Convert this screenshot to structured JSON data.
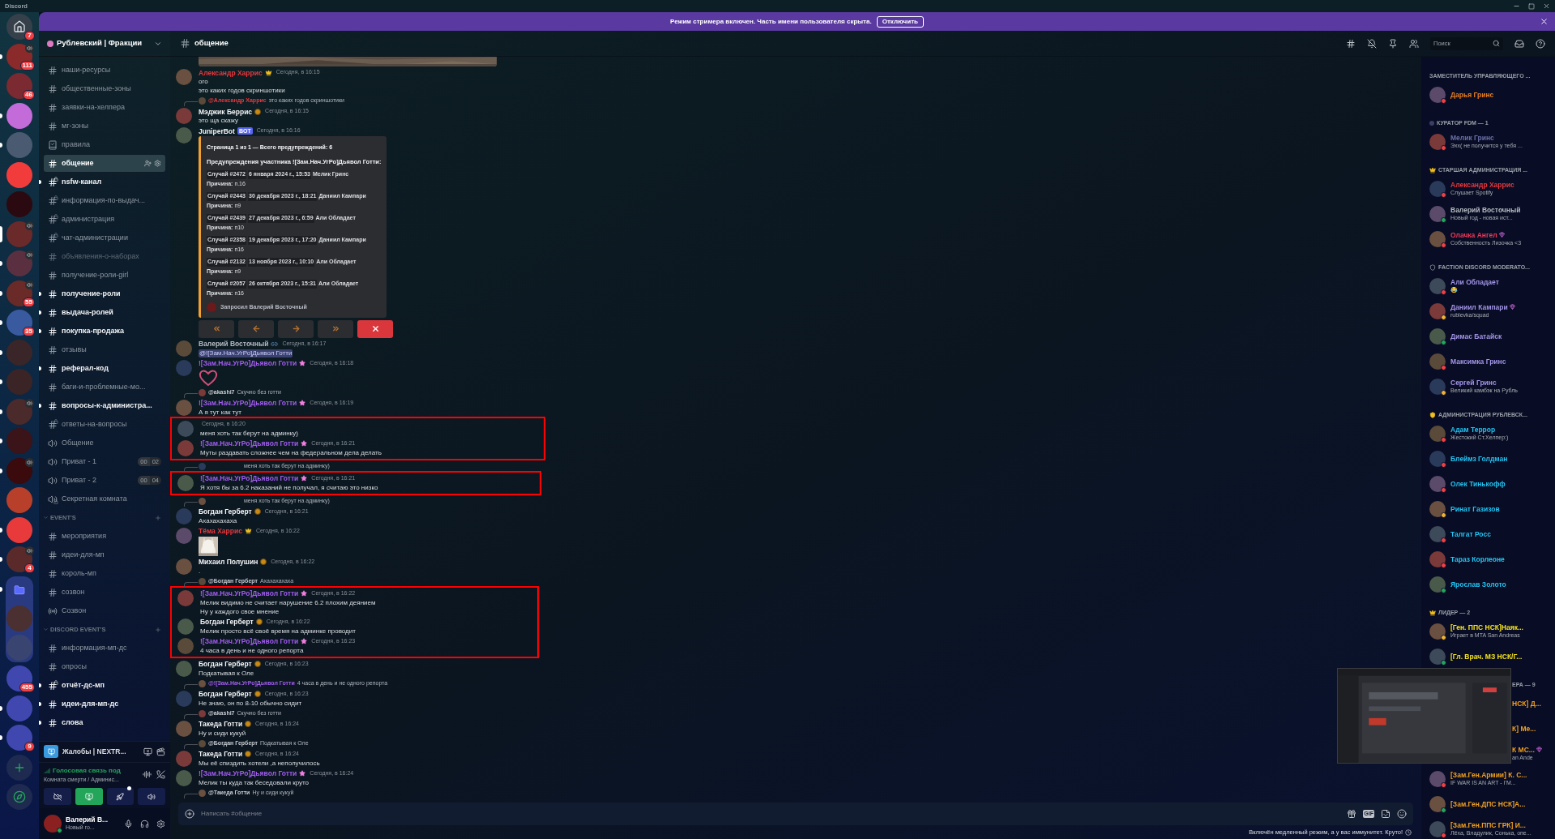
{
  "title_bar": {
    "app_name": "Discord"
  },
  "banner": {
    "text": "Режим стримера включен. Часть имени пользователя скрыта.",
    "button": "Отключить"
  },
  "servers": [
    {
      "kind": "home",
      "badge": "7",
      "unread": false,
      "selected": false,
      "speaker": false
    },
    {
      "kind": "server",
      "color": "#8a2a2a",
      "badge": "111",
      "unread": true,
      "selected": false,
      "speaker": true
    },
    {
      "kind": "server",
      "color": "#7a2a30",
      "badge": "46",
      "unread": false,
      "selected": false,
      "speaker": false
    },
    {
      "kind": "server",
      "color": "#c36bd9",
      "unread": true,
      "selected": false,
      "speaker": false
    },
    {
      "kind": "server",
      "color": "#4a5a70",
      "unread": true,
      "selected": false,
      "speaker": false
    },
    {
      "kind": "server",
      "color": "#f23c3c",
      "unread": false,
      "selected": false,
      "speaker": false
    },
    {
      "kind": "server",
      "color": "#2a0a10",
      "unread": false,
      "selected": false,
      "speaker": false
    },
    {
      "kind": "server",
      "color": "#6a2a2a",
      "unread": false,
      "selected": true,
      "speaker": true
    },
    {
      "kind": "server",
      "color": "#5a3040",
      "unread": true,
      "selected": false,
      "speaker": true
    },
    {
      "kind": "server",
      "color": "#6a2a28",
      "badge": "55",
      "unread": true,
      "selected": false,
      "speaker": true
    },
    {
      "kind": "server",
      "color": "#3a5aa0",
      "badge": "35",
      "unread": true,
      "selected": false,
      "speaker": false
    },
    {
      "kind": "server",
      "color": "#3a2628",
      "unread": true,
      "selected": false,
      "speaker": false
    },
    {
      "kind": "server",
      "color": "#3a2426",
      "unread": true,
      "selected": false,
      "speaker": false
    },
    {
      "kind": "server",
      "color": "#4a2a2a",
      "unread": true,
      "selected": false,
      "speaker": true
    },
    {
      "kind": "server",
      "color": "#3a1418",
      "unread": true,
      "selected": false,
      "speaker": false
    },
    {
      "kind": "server",
      "color": "#3a0a0c",
      "unread": true,
      "selected": false,
      "speaker": true
    },
    {
      "kind": "server",
      "color": "#b8402a",
      "unread": false,
      "selected": false,
      "speaker": false
    },
    {
      "kind": "server",
      "color": "#e83a3a",
      "unread": true,
      "selected": false,
      "speaker": false
    },
    {
      "kind": "server",
      "color": "#5a2a2a",
      "badge": "4",
      "unread": true,
      "selected": false,
      "speaker": true
    },
    {
      "kind": "folder",
      "children": [
        {
          "color": "#4a3030"
        },
        {
          "color": "#3a4470"
        }
      ],
      "unread": true,
      "selected": false,
      "speaker": false
    },
    {
      "kind": "server",
      "color": "#4048b0",
      "badge": "455",
      "unread": false,
      "selected": false,
      "speaker": false
    },
    {
      "kind": "server",
      "color": "#4048b0",
      "unread": true,
      "selected": false,
      "speaker": false
    },
    {
      "kind": "server",
      "color": "#4048b0",
      "badge": "9",
      "unread": true,
      "selected": false,
      "speaker": false
    },
    {
      "kind": "add",
      "unread": false,
      "selected": false,
      "speaker": false
    },
    {
      "kind": "discover",
      "unread": false,
      "selected": false,
      "speaker": false
    }
  ],
  "server": {
    "name": "Рублевский | Фракции"
  },
  "channels": [
    {
      "kind": "text",
      "name": "наши-ресурсы",
      "selected": false,
      "unread": false,
      "muted": false
    },
    {
      "kind": "text",
      "name": "общественные-зоны",
      "selected": false,
      "unread": false,
      "muted": false
    },
    {
      "kind": "text",
      "name": "заявки-на-хелпера",
      "selected": false,
      "unread": false,
      "muted": false
    },
    {
      "kind": "text",
      "name": "мг-зоны",
      "selected": false,
      "unread": false,
      "muted": false
    },
    {
      "kind": "rules",
      "name": "правила",
      "selected": false,
      "unread": false,
      "muted": false
    },
    {
      "kind": "text",
      "name": "общение",
      "selected": true,
      "unread": false,
      "muted": false
    },
    {
      "kind": "limited",
      "name": "nsfw-канал",
      "selected": false,
      "unread": true,
      "muted": false
    },
    {
      "kind": "limited",
      "name": "информация-по-выдач...",
      "selected": false,
      "unread": false,
      "muted": false
    },
    {
      "kind": "limited",
      "name": "администрация",
      "selected": false,
      "unread": false,
      "muted": false
    },
    {
      "kind": "limited",
      "name": "чат-администрации",
      "selected": false,
      "unread": false,
      "muted": false
    },
    {
      "kind": "text",
      "name": "объявления-о-наборах",
      "selected": false,
      "unread": false,
      "muted": true
    },
    {
      "kind": "text",
      "name": "получение-роли-girl",
      "selected": false,
      "unread": false,
      "muted": false
    },
    {
      "kind": "text",
      "name": "получение-роли",
      "selected": false,
      "unread": true,
      "muted": false
    },
    {
      "kind": "text",
      "name": "выдача-ролей",
      "selected": false,
      "unread": true,
      "muted": false
    },
    {
      "kind": "text",
      "name": "покупка-продажа",
      "selected": false,
      "unread": true,
      "muted": false
    },
    {
      "kind": "text",
      "name": "отзывы",
      "selected": false,
      "unread": false,
      "muted": false
    },
    {
      "kind": "text",
      "name": "реферал-код",
      "selected": false,
      "unread": true,
      "muted": false
    },
    {
      "kind": "text",
      "name": "баги-и-проблемные-мо...",
      "selected": false,
      "unread": false,
      "muted": false
    },
    {
      "kind": "text",
      "name": "вопросы-к-администра...",
      "selected": false,
      "unread": true,
      "muted": false
    },
    {
      "kind": "limited",
      "name": "ответы-на-вопросы",
      "selected": false,
      "unread": false,
      "muted": false
    },
    {
      "kind": "voice",
      "name": "Общение",
      "selected": false,
      "unread": false,
      "muted": false
    },
    {
      "kind": "voice",
      "name": "Приват - 1",
      "timer": [
        "00",
        "02"
      ],
      "selected": false,
      "unread": false,
      "muted": false
    },
    {
      "kind": "voice",
      "name": "Приват - 2",
      "timer": [
        "00",
        "04"
      ],
      "selected": false,
      "unread": false,
      "muted": false
    },
    {
      "kind": "voice-limited",
      "name": "Секретная комната",
      "selected": false,
      "unread": false,
      "muted": false
    },
    {
      "kind": "category",
      "name": "EVENT'S"
    },
    {
      "kind": "text",
      "name": "мероприятия",
      "selected": false,
      "unread": false,
      "muted": false
    },
    {
      "kind": "text",
      "name": "идеи-для-мп",
      "selected": false,
      "unread": false,
      "muted": false
    },
    {
      "kind": "text",
      "name": "король-мп",
      "selected": false,
      "unread": false,
      "muted": false
    },
    {
      "kind": "text",
      "name": "созвон",
      "selected": false,
      "unread": false,
      "muted": false
    },
    {
      "kind": "stage",
      "name": "Созвон",
      "selected": false,
      "unread": false,
      "muted": false
    },
    {
      "kind": "category",
      "name": "DISCORD EVENT'S"
    },
    {
      "kind": "text",
      "name": "информация-мп-дс",
      "selected": false,
      "unread": false,
      "muted": false
    },
    {
      "kind": "text",
      "name": "опросы",
      "selected": false,
      "unread": false,
      "muted": false
    },
    {
      "kind": "limited",
      "name": "отчёт-дс-мп",
      "selected": false,
      "unread": true,
      "muted": false
    },
    {
      "kind": "text",
      "name": "идеи-для-мп-дс",
      "selected": false,
      "unread": true,
      "muted": false
    },
    {
      "kind": "text",
      "name": "слова",
      "selected": false,
      "unread": true,
      "muted": false
    }
  ],
  "app_row": {
    "name": "Жалобы | NEXTR..."
  },
  "voice": {
    "status": "Голосовая связь под",
    "location": "Комната смерти / Админис...",
    "buttons": [
      {
        "kind": "camera",
        "active": false,
        "notify": false
      },
      {
        "kind": "screen",
        "active": true,
        "notify": false
      },
      {
        "kind": "activity",
        "active": false,
        "notify": true
      },
      {
        "kind": "soundboard",
        "active": false,
        "notify": false
      }
    ]
  },
  "user": {
    "name": "Валерий В...",
    "status": "Новый го...",
    "presence": {
      "kind": "online"
    }
  },
  "header": {
    "channel": "общение",
    "search_placeholder": "Поиск"
  },
  "chat": {
    "items": [
      {
        "kind": "attachment"
      },
      {
        "kind": "message",
        "author": "Александр Харрис",
        "color": "#e8383d",
        "badge": {
          "kind": "crown"
        },
        "time": "Сегодня, в 16:15",
        "lines": [
          "ого",
          "это каких годов скриншотики"
        ]
      },
      {
        "kind": "reply",
        "author": "@Александр Харрис",
        "color": "#e8383d",
        "text": "это каких годов скриншотики"
      },
      {
        "kind": "message",
        "author": "Мэджик Беррис",
        "color": "#f2f3f5",
        "badge": {
          "kind": "role"
        },
        "time": "Сегодня, в 16:15",
        "lines": [
          "это ща скажу"
        ]
      },
      {
        "kind": "message",
        "author": "JuniperBot",
        "color": "#f2f3f5",
        "tag": "BOT",
        "time": "Сегодня, в 16:16",
        "embed": {
          "title": "Страница 1 из 1 — Всего предупреждений: 6",
          "heading": "Предупреждения участника ![Зам.Нач.УгРо]Дьявол Готти:",
          "cases": [
            {
              "case": "Случай #2472",
              "date": "6 января 2024 г., 15:53",
              "by": "Мелик Гринс",
              "reason": "**Причина:** п.16"
            },
            {
              "case": "Случай #2443",
              "date": "30 декабря 2023 г., 18:21",
              "by": "Даниил Кампари",
              "reason": "**Причина:** п9"
            },
            {
              "case": "Случай #2439",
              "date": "27 декабря 2023 г., 6:59",
              "by": "Али Обладает",
              "reason": "**Причина:** п10"
            },
            {
              "case": "Случай #2358",
              "date": "19 декабря 2023 г., 17:20",
              "by": "Даниил Кампари",
              "reason": "**Причина:** п16"
            },
            {
              "case": "Случай #2132",
              "date": "13 ноября 2023 г., 10:10",
              "by": "Али Обладает",
              "reason": "**Причина:** п9"
            },
            {
              "case": "Случай #2057",
              "date": "26 октября 2023 г., 15:31",
              "by": "Али Обладает",
              "reason": "**Причина:** п16"
            }
          ],
          "footer": "Запросил Валерий Восточный"
        },
        "buttons": [
          {
            "kind": "first"
          },
          {
            "kind": "prev"
          },
          {
            "kind": "next"
          },
          {
            "kind": "last"
          },
          {
            "kind": "close"
          }
        ]
      },
      {
        "kind": "message",
        "author": "Валерий Восточный",
        "color": "#b5bac1",
        "badge": {
          "kind": "link"
        },
        "time": "Сегодня, в 16:17",
        "mention": "@![Зам.Нач.УгРо]Дьявол Готти"
      },
      {
        "kind": "message",
        "author": "![Зам.Нач.УгРо]Дьявол Готти",
        "color": "#a15cf0",
        "badge": {
          "kind": "star"
        },
        "time": "Сегодня, в 16:18",
        "sticker": {
          "kind": "heart"
        }
      },
      {
        "kind": "reply",
        "author": "@akashi7",
        "color": "#c9cdd2",
        "text": "Скучно без готти"
      },
      {
        "kind": "message",
        "author": "![Зам.Нач.УгРо]Дьявол Готти",
        "color": "#a15cf0",
        "badge": {
          "kind": "star"
        },
        "time": "Сегодня, в 16:19",
        "lines": [
          "А я тут как тут"
        ]
      },
      {
        "kind": "highlight",
        "items": [
          {
            "kind": "message",
            "time": "Сегодня, в 16:20",
            "lines": [
              "меня хоть так берут на админку)"
            ]
          },
          {
            "kind": "message",
            "author": "![Зам.Нач.УгРо]Дьявол Готти",
            "color": "#a15cf0",
            "badge": {
              "kind": "star"
            },
            "time": "Сегодня, в 16:21",
            "lines": [
              "Муты раздавать сложнее чем на федеральном дела делать"
            ]
          }
        ]
      },
      {
        "kind": "reply",
        "text": "меня хоть так берут на админку)"
      },
      {
        "kind": "highlight",
        "items": [
          {
            "kind": "message",
            "author": "![Зам.Нач.УгРо]Дьявол Готти",
            "color": "#a15cf0",
            "badge": {
              "kind": "star"
            },
            "time": "Сегодня, в 16:21",
            "lines": [
              "Я хотя бы за 6.2 наказаний не получал, я считаю это низко"
            ]
          }
        ]
      },
      {
        "kind": "reply",
        "text": "меня хоть так берут на админку)"
      },
      {
        "kind": "message",
        "author": "Богдан Герберт",
        "color": "#f2f3f5",
        "badge": {
          "kind": "role"
        },
        "time": "Сегодня, в 16:21",
        "lines": [
          "Ахахахахаха"
        ]
      },
      {
        "kind": "message",
        "author": "Тёма Харрис",
        "color": "#e8383d",
        "badge": {
          "kind": "crown"
        },
        "time": "Сегодня, в 16:22",
        "sticker": {
          "kind": "cat"
        }
      },
      {
        "kind": "message",
        "author": "Михаил Полушин",
        "color": "#f2f3f5",
        "badge": {
          "kind": "role"
        },
        "time": "Сегодня, в 16:22",
        "lines": [
          "."
        ]
      },
      {
        "kind": "reply",
        "author": "@Богдан Герберт",
        "color": "#c9cdd2",
        "text": "Ахахахахаха"
      },
      {
        "kind": "highlight",
        "items": [
          {
            "kind": "message",
            "author": "![Зам.Нач.УгРо]Дьявол Готти",
            "color": "#a15cf0",
            "badge": {
              "kind": "star"
            },
            "time": "Сегодня, в 16:22",
            "lines": [
              "Мелик видимо не считает нарушение 6.2 плохим деянием",
              "Ну у каждого свое мнение"
            ]
          },
          {
            "kind": "message",
            "author": "Богдан Герберт",
            "color": "#f2f3f5",
            "badge": {
              "kind": "role"
            },
            "time": "Сегодня, в 16:22",
            "lines": [
              "Мелик просто всё своё время на админке проводит"
            ]
          },
          {
            "kind": "message",
            "author": "![Зам.Нач.УгРо]Дьявол Готти",
            "color": "#a15cf0",
            "badge": {
              "kind": "star"
            },
            "time": "Сегодня, в 16:23",
            "lines": [
              "4 часа в день и не одного репорта"
            ]
          }
        ]
      },
      {
        "kind": "message",
        "author": "Богдан Герберт",
        "color": "#f2f3f5",
        "badge": {
          "kind": "role"
        },
        "time": "Сегодня, в 16:23",
        "lines": [
          "Подкатывая к Оле"
        ]
      },
      {
        "kind": "reply",
        "author": "@![Зам.Нач.УгРо]Дьявол Готти",
        "color": "#a15cf0",
        "text": "4 часа в день и не одного репорта"
      },
      {
        "kind": "message",
        "author": "Богдан Герберт",
        "color": "#f2f3f5",
        "badge": {
          "kind": "role"
        },
        "time": "Сегодня, в 16:23",
        "lines": [
          "Не знаю, он по 8-10 обычно сидит"
        ]
      },
      {
        "kind": "reply",
        "author": "@akashi7",
        "color": "#c9cdd2",
        "text": "Скучно без готти"
      },
      {
        "kind": "message",
        "author": "Такеда Готти",
        "color": "#f2f3f5",
        "badge": {
          "kind": "role"
        },
        "time": "Сегодня, в 16:24",
        "lines": [
          "Ну и сиди кукуй"
        ]
      },
      {
        "kind": "reply",
        "author": "@Богдан Герберт",
        "color": "#c9cdd2",
        "text": "Подкатывая к Оле"
      },
      {
        "kind": "message",
        "author": "Такеда Готти",
        "color": "#f2f3f5",
        "badge": {
          "kind": "role"
        },
        "time": "Сегодня, в 16:24",
        "lines": [
          "Мы её спиздить хотели ,а неполучилось"
        ]
      },
      {
        "kind": "message",
        "author": "![Зам.Нач.УгРо]Дьявол Готти",
        "color": "#a15cf0",
        "badge": {
          "kind": "star"
        },
        "time": "Сегодня, в 16:24",
        "lines": [
          "Мелик ты куда так беседовали круто"
        ]
      },
      {
        "kind": "reply",
        "author": "@Такеда Готти",
        "color": "#c9cdd2",
        "text": "Ну и сиди кукуй"
      }
    ]
  },
  "input": {
    "placeholder": "Написать #общение",
    "gif_label": "GIF"
  },
  "slowmode": "Включён медленный режим, а у вас иммунитет. Круто!",
  "members": [
    {
      "title": "ЗАМЕСТИТЕЛЬ УПРАВЛЯЮЩЕГО ...",
      "kind": "plain",
      "members": [
        {
          "name": "Дарья Гринс",
          "color": "#e67e22",
          "status": {
            "kind": "dnd"
          },
          "boost": false
        }
      ]
    },
    {
      "title": "КУРАТОР FDM — 1",
      "kind": "dot",
      "members": [
        {
          "name": "Мелик Гринс",
          "color": "#6a70a8",
          "status": {
            "kind": "dnd"
          },
          "boost": false,
          "activity": "Эхх( не получится у тебя ..."
        }
      ]
    },
    {
      "title": "СТАРШАЯ АДМИНИСТРАЦИЯ ...",
      "kind": "crown",
      "members": [
        {
          "name": "Александр Харрис",
          "color": "#e8383d",
          "status": {
            "kind": "dnd"
          },
          "boost": false,
          "activity": "Слушает Spotify"
        },
        {
          "name": "Валерий Восточный",
          "color": "#b5bac1",
          "status": {
            "kind": "online"
          },
          "boost": false,
          "activity": "Новый год - новая ист..."
        },
        {
          "name": "Олачка Ангел",
          "color": "#ee3a5a",
          "status": {
            "kind": "dnd"
          },
          "boost": true,
          "activity": "Собственность Лизочка <3"
        }
      ]
    },
    {
      "title": "FACTION DISCORD MODERATO...",
      "kind": "shield",
      "members": [
        {
          "name": "Али Обладает",
          "color": "#a294e6",
          "status": {
            "kind": "dnd"
          },
          "boost": false,
          "activity": "😂"
        },
        {
          "name": "Даниил Кампари",
          "color": "#a294e6",
          "status": {
            "kind": "idle"
          },
          "boost": true,
          "activity": "rublevka/squad"
        },
        {
          "name": "Димас Батайск",
          "color": "#a294e6",
          "status": {
            "kind": "online"
          },
          "boost": false
        },
        {
          "name": "Максимка Гринс",
          "color": "#a294e6",
          "status": {
            "kind": "dnd"
          },
          "boost": false
        },
        {
          "name": "Сергей Гринс",
          "color": "#a294e6",
          "status": {
            "kind": "idle"
          },
          "boost": false,
          "activity": "Великий камбэк на Рубль"
        }
      ]
    },
    {
      "title": "АДМИНИСТРАЦИЯ РУБЛЕВСК...",
      "kind": "badge",
      "members": [
        {
          "name": "Адам Террор",
          "color": "#22c4f2",
          "status": {
            "kind": "dnd"
          },
          "boost": false,
          "activity": "Жестокий Ст.Хелпер:)"
        },
        {
          "name": "Блеймз Голдман",
          "color": "#22c4f2",
          "status": {
            "kind": "dnd"
          },
          "boost": false
        },
        {
          "name": "Олек Тинькофф",
          "color": "#22c4f2",
          "status": {
            "kind": "dnd"
          },
          "boost": false
        },
        {
          "name": "Ринат Газизов",
          "color": "#22c4f2",
          "status": {
            "kind": "idle"
          },
          "boost": false
        },
        {
          "name": "Талгат Росс",
          "color": "#22c4f2",
          "status": {
            "kind": "dnd"
          },
          "boost": false
        },
        {
          "name": "Тараз Корлеоне",
          "color": "#22c4f2",
          "status": {
            "kind": "dnd"
          },
          "boost": false
        },
        {
          "name": "Ярослав Золото",
          "color": "#22c4f2",
          "status": {
            "kind": "online"
          },
          "boost": false
        }
      ]
    },
    {
      "title": "ЛИДЕР — 2",
      "kind": "crown",
      "members": [
        {
          "name": "[Ген. ППС НСК]Наяк...",
          "color": "#f5e31c",
          "status": {
            "kind": "idle"
          },
          "boost": false,
          "activity": "Играет в MTA San Andreas"
        },
        {
          "name": "[Гл. Врач. МЗ НСК/Г...",
          "color": "#f5e31c",
          "status": {
            "kind": "online"
          },
          "boost": false
        }
      ]
    },
    {
      "title": "ЕРА — 9",
      "kind": "plain",
      "partial": true,
      "members": [
        {
          "name": "НСК] Д...",
          "color": "#f0a020",
          "boost": false,
          "partial": true
        },
        {
          "name": "К] Ме...",
          "color": "#f0a020",
          "boost": false,
          "partial": true
        },
        {
          "name": "К МС...",
          "color": "#f0a020",
          "boost": true,
          "partial": true,
          "activity": "an Ande"
        },
        {
          "name": "[Зам.Ген.Армии] К. С...",
          "color": "#f0a020",
          "status": {
            "kind": "dnd"
          },
          "boost": false,
          "partial": false,
          "activity": "IF WAR IS AN ART - I'M..."
        },
        {
          "name": "[Зам.Ген.ДПС НСК]А...",
          "color": "#f0a020",
          "status": {
            "kind": "online"
          },
          "boost": false,
          "partial": false
        },
        {
          "name": "[Зам.Ген.ППС ГРК] И...",
          "color": "#f0a020",
          "status": {
            "kind": "dnd"
          },
          "boost": false,
          "partial": false,
          "activity": "Лёха, Владулик, Сонька, опе..."
        }
      ]
    }
  ]
}
